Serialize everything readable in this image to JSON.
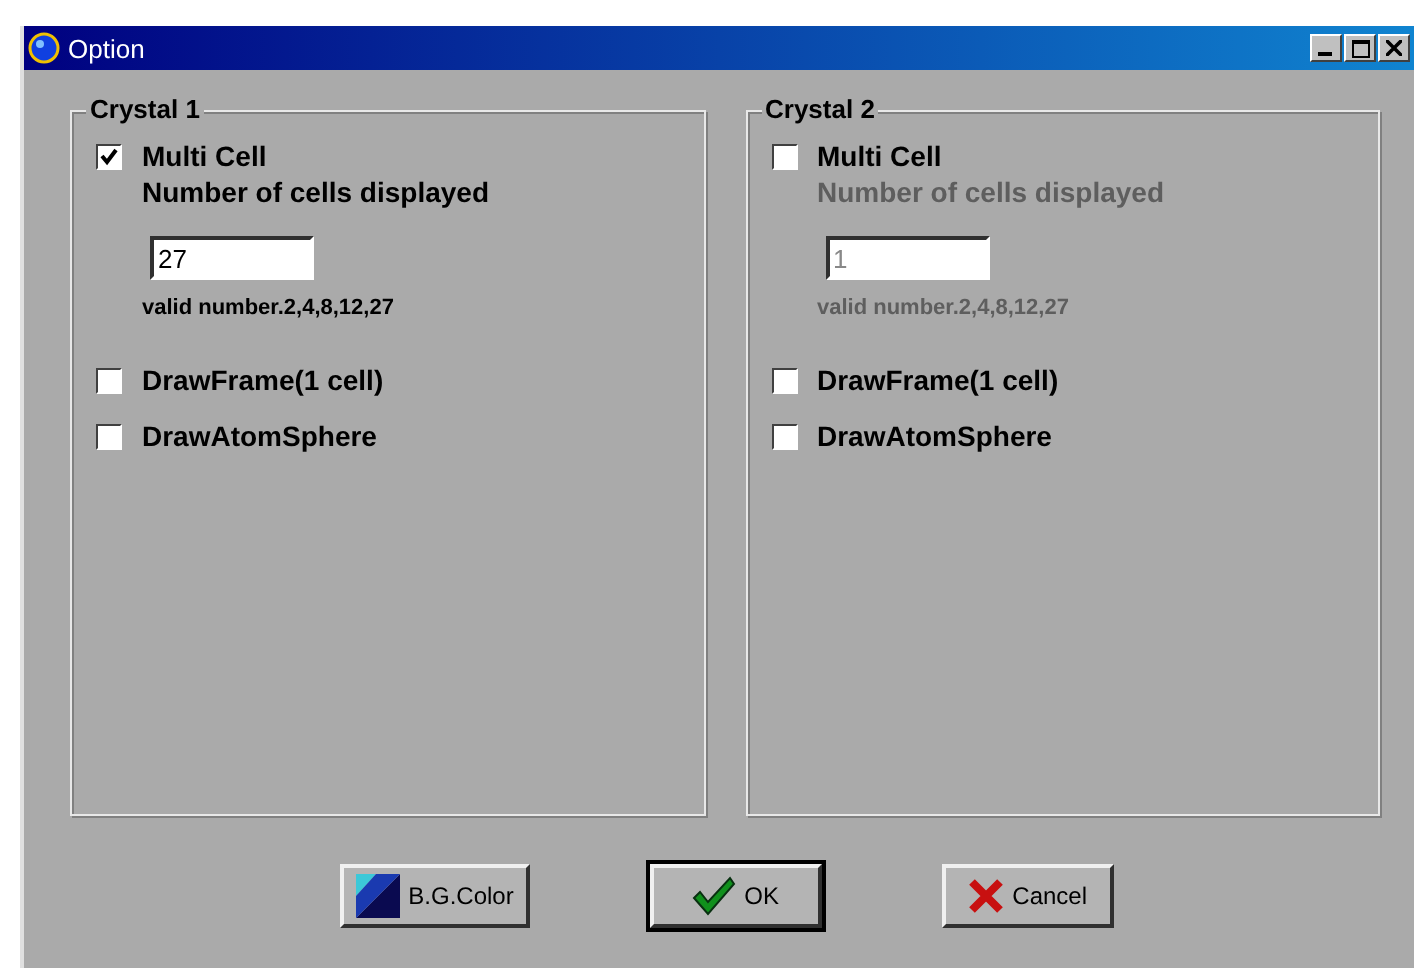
{
  "window": {
    "title": "Option"
  },
  "groups": [
    {
      "title": "Crystal 1",
      "multi_cell": {
        "label": "Multi Cell",
        "checked": true
      },
      "count_label": "Number of cells displayed",
      "count_value": "27",
      "valid_note": "valid number.2,4,8,12,27",
      "options": [
        {
          "label": "DrawFrame(1 cell)",
          "checked": false
        },
        {
          "label": "DrawAtomSphere",
          "checked": false
        }
      ]
    },
    {
      "title": "Crystal 2",
      "multi_cell": {
        "label": "Multi Cell",
        "checked": false
      },
      "count_label": "Number of cells displayed",
      "count_value": "1",
      "valid_note": "valid number.2,4,8,12,27",
      "options": [
        {
          "label": "DrawFrame(1 cell)",
          "checked": false
        },
        {
          "label": "DrawAtomSphere",
          "checked": false
        }
      ]
    }
  ],
  "buttons": [
    {
      "label": "B.G.Color",
      "kind": "color",
      "default": false
    },
    {
      "label": "OK",
      "kind": "ok",
      "default": true
    },
    {
      "label": "Cancel",
      "kind": "cancel",
      "default": false
    }
  ]
}
